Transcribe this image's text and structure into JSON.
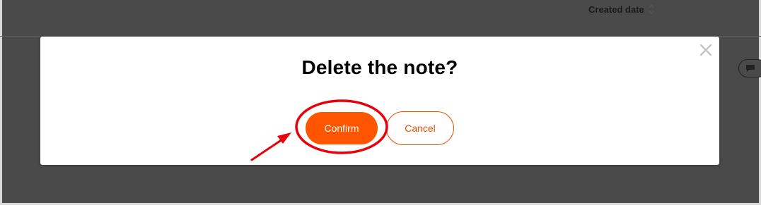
{
  "header": {
    "sort_column_label": "Created date"
  },
  "dialog": {
    "title": "Delete the note?",
    "confirm_label": "Confirm",
    "cancel_label": "Cancel"
  },
  "colors": {
    "overlay": "#4a4a4a",
    "primary": "#ff5500",
    "cancel_text": "#e65100",
    "annotation": "#e8000b"
  },
  "icons": {
    "close": "close-icon",
    "sort": "sort-icon",
    "comment": "comment-icon"
  }
}
